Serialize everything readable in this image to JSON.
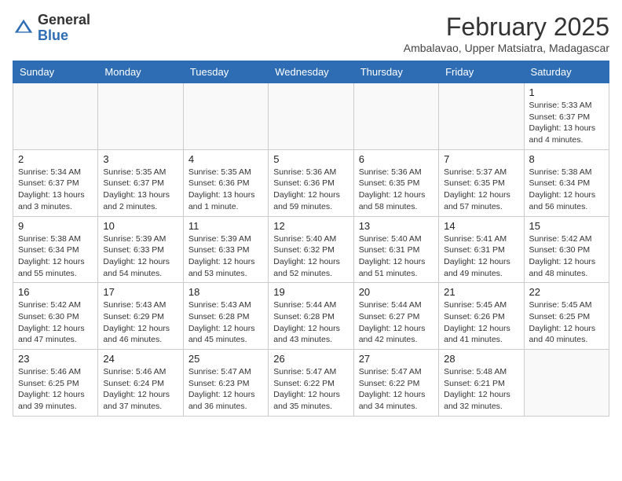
{
  "header": {
    "logo": {
      "general": "General",
      "blue": "Blue"
    },
    "month_year": "February 2025",
    "location": "Ambalavao, Upper Matsiatra, Madagascar"
  },
  "days_of_week": [
    "Sunday",
    "Monday",
    "Tuesday",
    "Wednesday",
    "Thursday",
    "Friday",
    "Saturday"
  ],
  "weeks": [
    [
      {
        "day": "",
        "info": ""
      },
      {
        "day": "",
        "info": ""
      },
      {
        "day": "",
        "info": ""
      },
      {
        "day": "",
        "info": ""
      },
      {
        "day": "",
        "info": ""
      },
      {
        "day": "",
        "info": ""
      },
      {
        "day": "1",
        "info": "Sunrise: 5:33 AM\nSunset: 6:37 PM\nDaylight: 13 hours\nand 4 minutes."
      }
    ],
    [
      {
        "day": "2",
        "info": "Sunrise: 5:34 AM\nSunset: 6:37 PM\nDaylight: 13 hours\nand 3 minutes."
      },
      {
        "day": "3",
        "info": "Sunrise: 5:35 AM\nSunset: 6:37 PM\nDaylight: 13 hours\nand 2 minutes."
      },
      {
        "day": "4",
        "info": "Sunrise: 5:35 AM\nSunset: 6:36 PM\nDaylight: 13 hours\nand 1 minute."
      },
      {
        "day": "5",
        "info": "Sunrise: 5:36 AM\nSunset: 6:36 PM\nDaylight: 12 hours\nand 59 minutes."
      },
      {
        "day": "6",
        "info": "Sunrise: 5:36 AM\nSunset: 6:35 PM\nDaylight: 12 hours\nand 58 minutes."
      },
      {
        "day": "7",
        "info": "Sunrise: 5:37 AM\nSunset: 6:35 PM\nDaylight: 12 hours\nand 57 minutes."
      },
      {
        "day": "8",
        "info": "Sunrise: 5:38 AM\nSunset: 6:34 PM\nDaylight: 12 hours\nand 56 minutes."
      }
    ],
    [
      {
        "day": "9",
        "info": "Sunrise: 5:38 AM\nSunset: 6:34 PM\nDaylight: 12 hours\nand 55 minutes."
      },
      {
        "day": "10",
        "info": "Sunrise: 5:39 AM\nSunset: 6:33 PM\nDaylight: 12 hours\nand 54 minutes."
      },
      {
        "day": "11",
        "info": "Sunrise: 5:39 AM\nSunset: 6:33 PM\nDaylight: 12 hours\nand 53 minutes."
      },
      {
        "day": "12",
        "info": "Sunrise: 5:40 AM\nSunset: 6:32 PM\nDaylight: 12 hours\nand 52 minutes."
      },
      {
        "day": "13",
        "info": "Sunrise: 5:40 AM\nSunset: 6:31 PM\nDaylight: 12 hours\nand 51 minutes."
      },
      {
        "day": "14",
        "info": "Sunrise: 5:41 AM\nSunset: 6:31 PM\nDaylight: 12 hours\nand 49 minutes."
      },
      {
        "day": "15",
        "info": "Sunrise: 5:42 AM\nSunset: 6:30 PM\nDaylight: 12 hours\nand 48 minutes."
      }
    ],
    [
      {
        "day": "16",
        "info": "Sunrise: 5:42 AM\nSunset: 6:30 PM\nDaylight: 12 hours\nand 47 minutes."
      },
      {
        "day": "17",
        "info": "Sunrise: 5:43 AM\nSunset: 6:29 PM\nDaylight: 12 hours\nand 46 minutes."
      },
      {
        "day": "18",
        "info": "Sunrise: 5:43 AM\nSunset: 6:28 PM\nDaylight: 12 hours\nand 45 minutes."
      },
      {
        "day": "19",
        "info": "Sunrise: 5:44 AM\nSunset: 6:28 PM\nDaylight: 12 hours\nand 43 minutes."
      },
      {
        "day": "20",
        "info": "Sunrise: 5:44 AM\nSunset: 6:27 PM\nDaylight: 12 hours\nand 42 minutes."
      },
      {
        "day": "21",
        "info": "Sunrise: 5:45 AM\nSunset: 6:26 PM\nDaylight: 12 hours\nand 41 minutes."
      },
      {
        "day": "22",
        "info": "Sunrise: 5:45 AM\nSunset: 6:25 PM\nDaylight: 12 hours\nand 40 minutes."
      }
    ],
    [
      {
        "day": "23",
        "info": "Sunrise: 5:46 AM\nSunset: 6:25 PM\nDaylight: 12 hours\nand 39 minutes."
      },
      {
        "day": "24",
        "info": "Sunrise: 5:46 AM\nSunset: 6:24 PM\nDaylight: 12 hours\nand 37 minutes."
      },
      {
        "day": "25",
        "info": "Sunrise: 5:47 AM\nSunset: 6:23 PM\nDaylight: 12 hours\nand 36 minutes."
      },
      {
        "day": "26",
        "info": "Sunrise: 5:47 AM\nSunset: 6:22 PM\nDaylight: 12 hours\nand 35 minutes."
      },
      {
        "day": "27",
        "info": "Sunrise: 5:47 AM\nSunset: 6:22 PM\nDaylight: 12 hours\nand 34 minutes."
      },
      {
        "day": "28",
        "info": "Sunrise: 5:48 AM\nSunset: 6:21 PM\nDaylight: 12 hours\nand 32 minutes."
      },
      {
        "day": "",
        "info": ""
      }
    ]
  ]
}
